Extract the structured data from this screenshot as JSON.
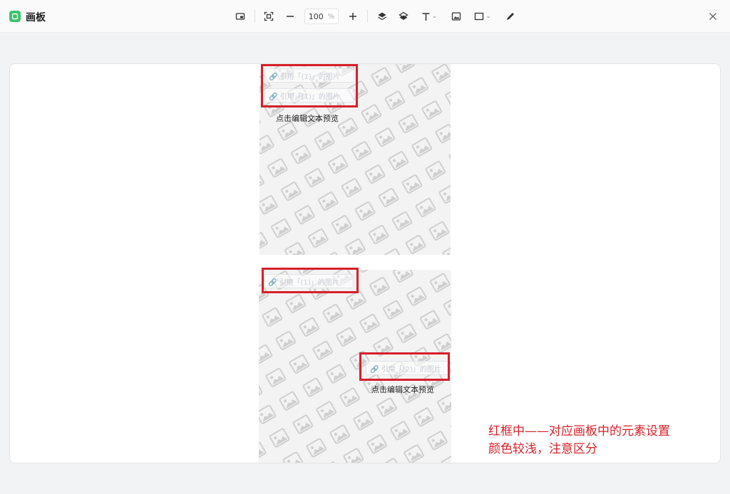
{
  "app": {
    "title": "画板",
    "accent": "#3cc16b"
  },
  "toolbar": {
    "zoom_value": "100",
    "zoom_unit": "%",
    "icons": [
      "artboard-icon",
      "fit-screen-icon",
      "zoom-out-icon",
      "zoom-in-icon",
      "layer-up-icon",
      "layer-down-icon",
      "text-tool-icon",
      "image-tool-icon",
      "shape-tool-icon",
      "pen-tool-icon",
      "close-icon"
    ]
  },
  "card_top": {
    "ref_tag_1": "🔗 引用「(1)」的图片",
    "ref_tag_2": "🔗 引用「(1)」的图片",
    "caption": "点击编辑文本预览"
  },
  "card_bottom": {
    "ref_tag_1": "🔗 引用「(1)」的图片",
    "ref_tag_2": "🔗 引用「(2)」的图片",
    "caption": "点击编辑文本预览"
  },
  "annotation": {
    "line1": "红框中——对应画板中的元素设置",
    "line2": "颜色较浅，注意区分",
    "color": "#d6202a"
  }
}
